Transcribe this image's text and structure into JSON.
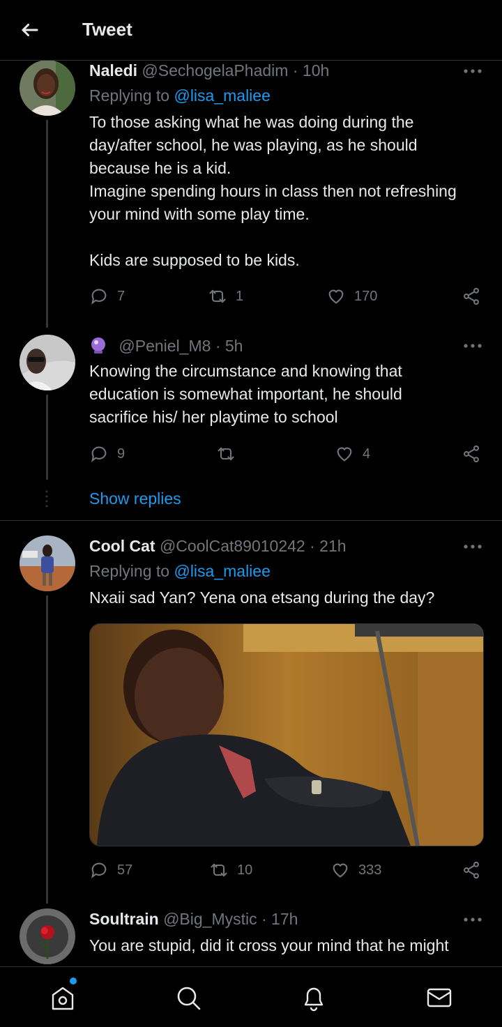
{
  "header": {
    "title": "Tweet"
  },
  "tweets": [
    {
      "name": "Naledi",
      "handle": "@SechogelaPhadim",
      "time": "· 10h",
      "replying_label": "Replying to",
      "replying_handle": "@lisa_maliee",
      "lines": [
        "To those asking what he was doing during the",
        "day/after school, he was playing, as he should",
        "because he is a kid.",
        "Imagine spending hours in class then not refreshing",
        "your mind with some play time.",
        "Kids are supposed to be kids."
      ],
      "replies": "7",
      "retweets": "1",
      "likes": "170"
    },
    {
      "name": "",
      "handle": "@Peniel_M8",
      "time": "· 5h",
      "lines": [
        "Knowing the circumstance and knowing that",
        "education is somewhat important, he should",
        "sacrifice his/ her playtime to school"
      ],
      "replies": "9",
      "retweets": "",
      "likes": "4"
    },
    {
      "name": "Cool Cat",
      "handle": "@CoolCat89010242",
      "time": "· 21h",
      "replying_label": "Replying to",
      "replying_handle": "@lisa_maliee",
      "lines": [
        "Nxaii sad Yan? Yena ona etsang during the day?"
      ],
      "replies": "57",
      "retweets": "10",
      "likes": "333"
    },
    {
      "name": "Soultrain",
      "handle": "@Big_Mystic",
      "time": "· 17h",
      "lines": [
        "You are stupid, did it cross your mind that he might"
      ]
    }
  ],
  "show_replies": "Show replies",
  "icons": {
    "back": "arrow-left-icon",
    "more": "more-icon",
    "reply": "reply-icon",
    "retweet": "retweet-icon",
    "like": "heart-icon",
    "share": "share-icon",
    "home": "home-icon",
    "search": "search-icon",
    "notifications": "bell-icon",
    "messages": "mail-icon"
  },
  "colors": {
    "accent": "#1d9bf0",
    "muted": "#71767b",
    "text": "#e7e9ea",
    "background": "#000000"
  }
}
